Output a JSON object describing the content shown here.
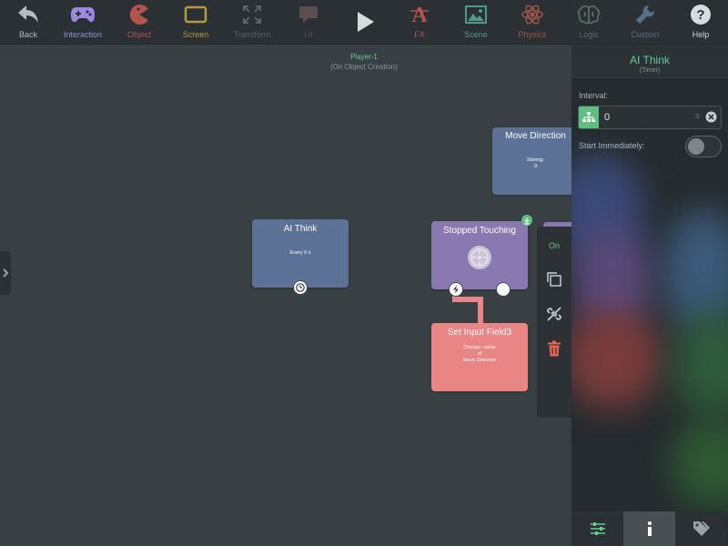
{
  "toolbar": {
    "items": [
      {
        "label": "Back",
        "icon": "back-arrow-icon",
        "color": "#b7bdbf"
      },
      {
        "label": "Interaction",
        "icon": "gamepad-icon",
        "color": "#9b8ae0"
      },
      {
        "label": "Object",
        "icon": "pacman-icon",
        "color": "#b5544a"
      },
      {
        "label": "Screen",
        "icon": "screen-icon",
        "color": "#b89a3e"
      },
      {
        "label": "Transform",
        "icon": "expand-icon",
        "color": "#59636a"
      },
      {
        "label": "UI",
        "icon": "speech-bubble-icon",
        "color": "#5a4e4e"
      },
      {
        "label": "",
        "icon": "play-icon",
        "color": "#d8dcdd"
      },
      {
        "label": "FX",
        "icon": "fx-icon",
        "color": "#b5544a"
      },
      {
        "label": "Scene",
        "icon": "image-icon",
        "color": "#4f9a8c"
      },
      {
        "label": "Physics",
        "icon": "atom-icon",
        "color": "#9a5448"
      },
      {
        "label": "Logic",
        "icon": "brain-icon",
        "color": "#57705e"
      },
      {
        "label": "Custom",
        "icon": "wrench-icon",
        "color": "#5a6f8a"
      },
      {
        "label": "Help",
        "icon": "help-icon",
        "color": "#d8dcdd"
      }
    ]
  },
  "scene": {
    "name": "Player-1",
    "subtitle": "(On Object Creation)"
  },
  "nodes": {
    "ai_think": {
      "title": "AI Think",
      "detail": "Every 0 s",
      "color": "#5c7196"
    },
    "move_direction": {
      "title": "Move Direction",
      "detail_line1": "Storing:",
      "detail_line2": "0",
      "color": "#5c7196"
    },
    "stopped_touching": {
      "title": "Stopped Touching",
      "color": "#8a78b0"
    },
    "set_input": {
      "title": "Set Input Field3",
      "line1": "Change: value",
      "line2": "of",
      "line3": "Move Direction",
      "color": "#ea8585"
    }
  },
  "context_menu": {
    "on_label": "On"
  },
  "panel": {
    "title": "AI Think",
    "subtitle": "(Timer)",
    "interval_label": "Interval:",
    "interval_value": "0",
    "interval_unit": "S",
    "start_label": "Start Immediately:",
    "start_immediately": false,
    "accent": "#5fd08f"
  }
}
